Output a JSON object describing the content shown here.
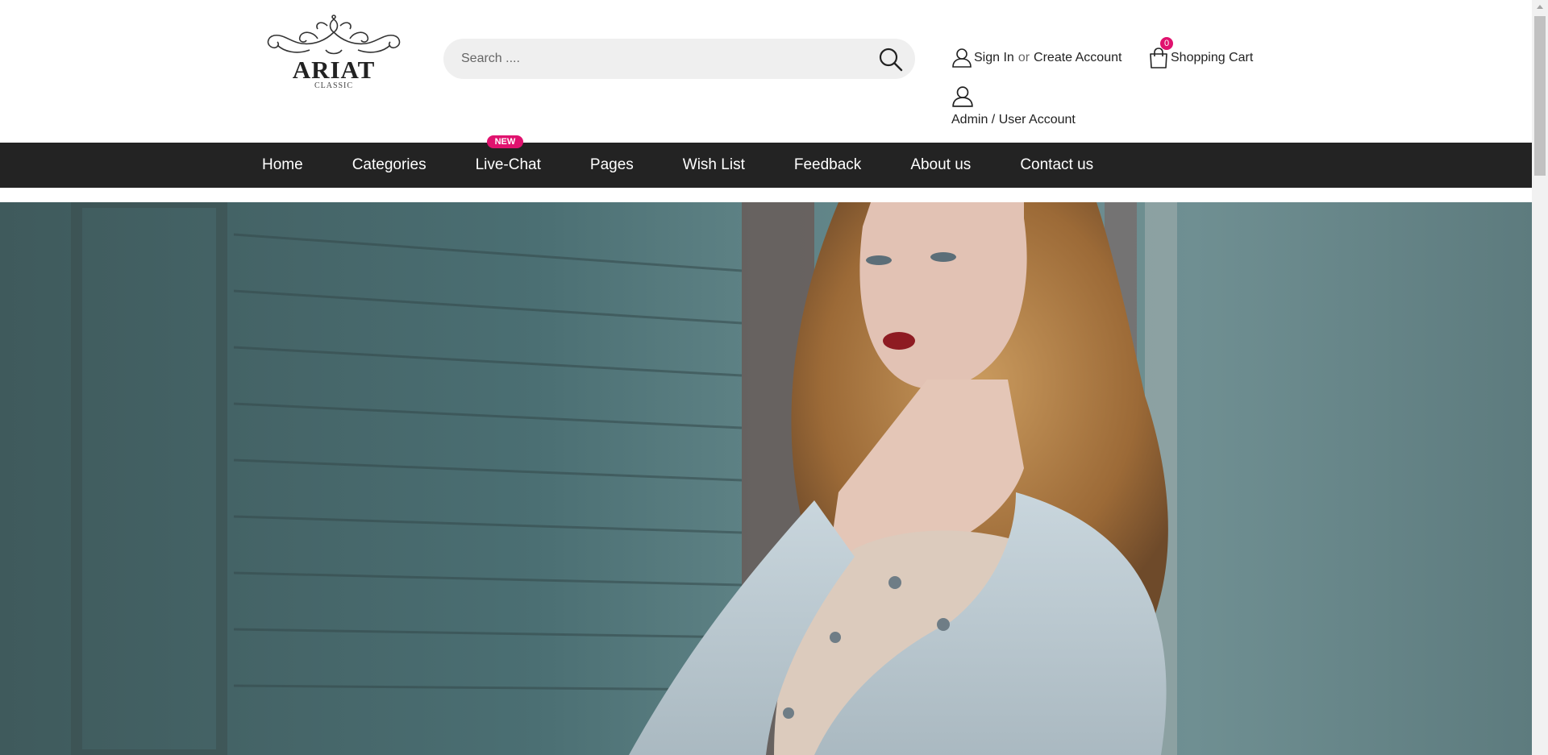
{
  "brand": {
    "name": "ARIAT",
    "tagline": "CLASSIC"
  },
  "search": {
    "placeholder": "Search ...."
  },
  "account": {
    "sign_in": "Sign In",
    "or": "or",
    "create": "Create Account",
    "admin": "Admin / User Account"
  },
  "cart": {
    "label": "Shopping Cart",
    "count": "0"
  },
  "nav": {
    "items": [
      {
        "label": "Home"
      },
      {
        "label": "Categories"
      },
      {
        "label": "Live-Chat",
        "badge": "NEW"
      },
      {
        "label": "Pages"
      },
      {
        "label": "Wish List"
      },
      {
        "label": "Feedback"
      },
      {
        "label": "About us"
      },
      {
        "label": "Contact us"
      }
    ]
  },
  "colors": {
    "accent": "#e0126e",
    "nav_bg": "#232323",
    "search_bg": "#efefef"
  },
  "icons": {
    "search": "search-icon",
    "user": "user-icon",
    "cart": "shopping-bag-icon"
  }
}
